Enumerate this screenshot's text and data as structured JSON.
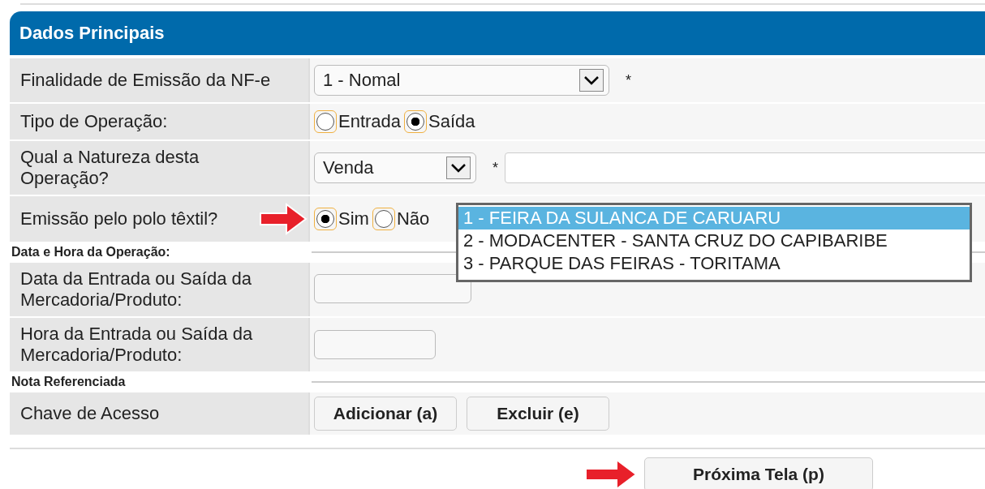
{
  "section": {
    "title": "Dados Principais"
  },
  "rows": [
    {
      "kind": "select",
      "label": "Finalidade de Emissão da NF-e",
      "value": "1 - Nomal",
      "required": "*"
    },
    {
      "kind": "radio",
      "label": "Tipo de Operação:",
      "options": [
        {
          "label": "Entrada",
          "selected": false
        },
        {
          "label": "Saída",
          "selected": true
        }
      ]
    },
    {
      "kind": "select_text",
      "label": "Qual a Natureza desta Operação?",
      "value": "Venda",
      "required": "*"
    },
    {
      "kind": "radio",
      "label": "Emissão pelo polo têxtil?",
      "annotated": true,
      "options": [
        {
          "label": "Sim",
          "selected": true
        },
        {
          "label": "Não",
          "selected": false
        }
      ],
      "dropdown": [
        {
          "label": "1 - FEIRA DA SULANCA DE CARUARU",
          "selected": true
        },
        {
          "label": "2 - MODACENTER - SANTA CRUZ DO CAPIBARIBE",
          "selected": false
        },
        {
          "label": "3 - PARQUE DAS FEIRAS - TORITAMA",
          "selected": false
        }
      ]
    },
    {
      "kind": "heading",
      "label": "Data e Hora da Operação:"
    },
    {
      "kind": "date",
      "label": "Data da Entrada ou Saída da Mercadoria/Produto:"
    },
    {
      "kind": "time",
      "label": "Hora da Entrada ou Saída da Mercadoria/Produto:"
    },
    {
      "kind": "heading",
      "label": "Nota Referenciada"
    },
    {
      "kind": "buttons",
      "label": "Chave de Acesso",
      "buttons": [
        "Adicionar (a)",
        "Excluir (e)"
      ]
    }
  ],
  "next_button": {
    "label": "Próxima Tela (p)",
    "annotated": true
  }
}
